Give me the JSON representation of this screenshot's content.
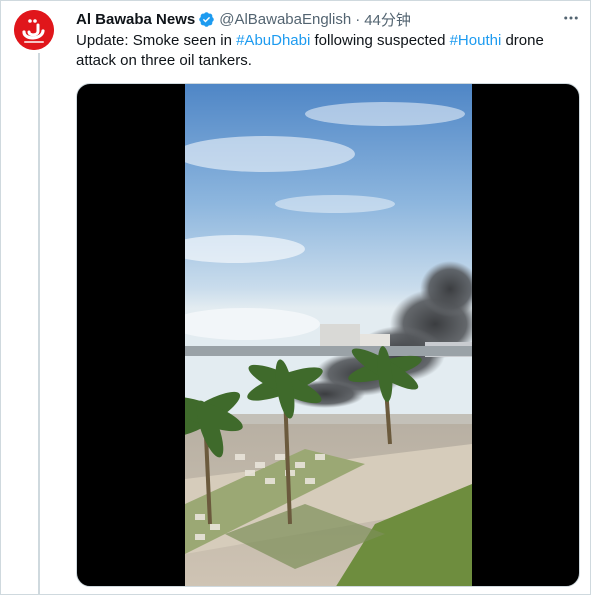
{
  "tweet": {
    "display_name": "Al Bawaba News",
    "handle": "@AlBawabaEnglish",
    "separator": "·",
    "time": "44分钟",
    "text_parts": {
      "t1": "Update: Smoke seen in ",
      "h1": "#AbuDhabi",
      "t2": " following suspected ",
      "h2": "#Houthi",
      "t3": " drone attack on three oil tankers."
    }
  },
  "icons": {
    "avatar": "al-bawaba-logo",
    "verified": "verified-badge-icon",
    "more": "more-horizontal-icon"
  },
  "avatar_logo": {
    "glyph": "ئـ",
    "caption": "albawaba.com"
  },
  "colors": {
    "link": "#1d9bf0",
    "verified": "#1d9bf0",
    "avatar_bg": "#e0161b",
    "text": "#0f1419",
    "secondary": "#536471",
    "border": "#cfd9de"
  }
}
